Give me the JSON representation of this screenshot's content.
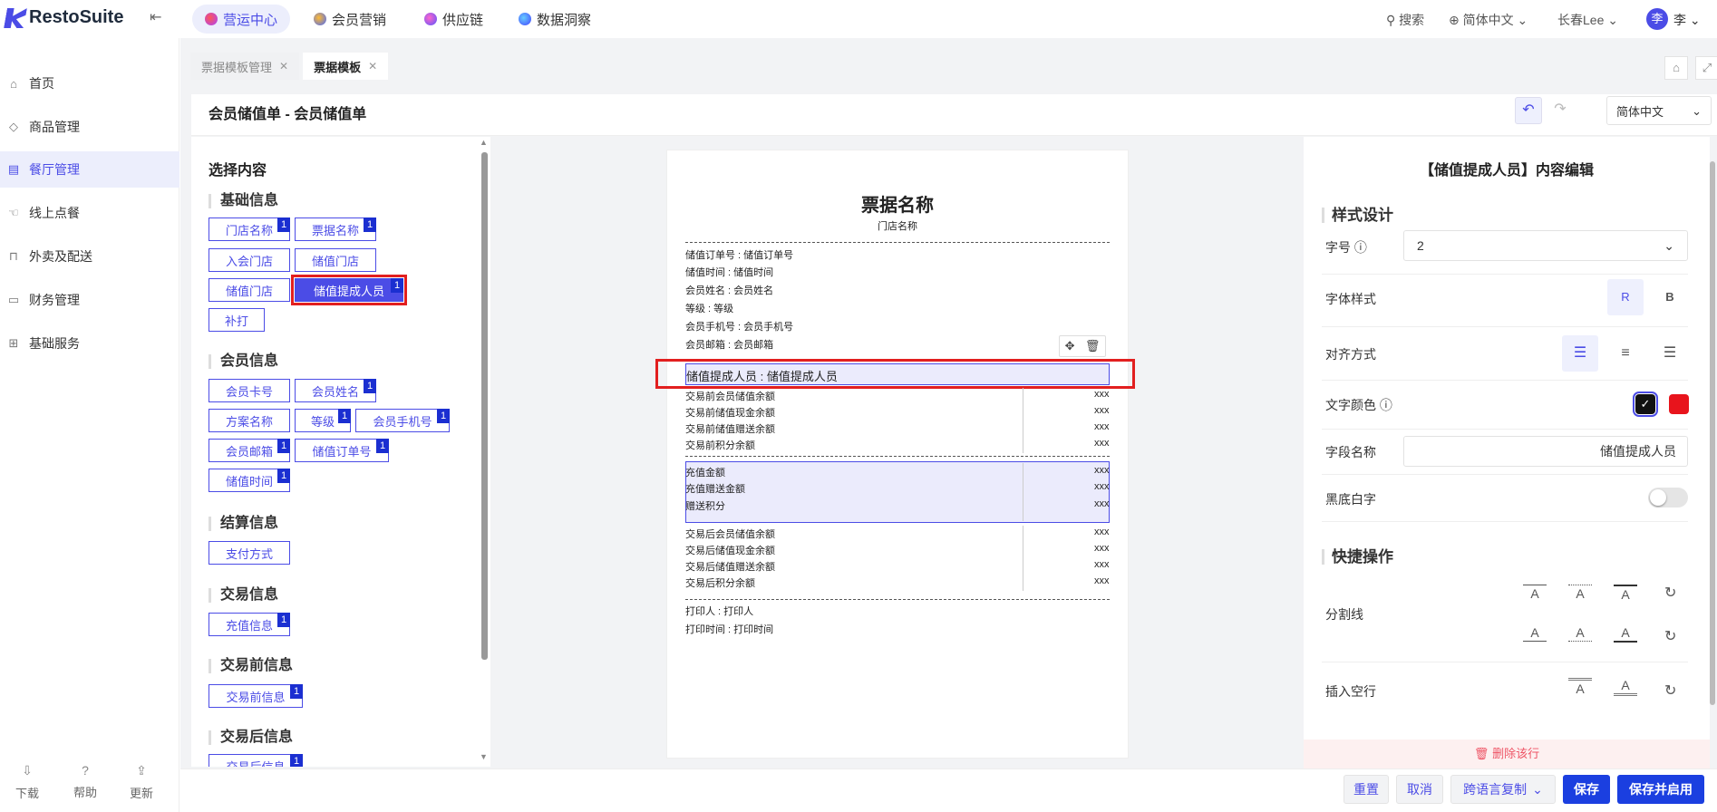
{
  "app": {
    "name": "RestoSuite"
  },
  "topnav": {
    "tabs": [
      {
        "label": "营运中心"
      },
      {
        "label": "会员营销"
      },
      {
        "label": "供应链"
      },
      {
        "label": "数据洞察"
      }
    ],
    "search": "搜索",
    "language": "简体中文",
    "store": "长春Lee",
    "avatar": "李",
    "user": "李"
  },
  "sidebar": {
    "items": [
      {
        "label": "首页"
      },
      {
        "label": "商品管理"
      },
      {
        "label": "餐厅管理"
      },
      {
        "label": "线上点餐"
      },
      {
        "label": "外卖及配送"
      },
      {
        "label": "财务管理"
      },
      {
        "label": "基础服务"
      }
    ],
    "footer": [
      {
        "label": "下载"
      },
      {
        "label": "帮助"
      },
      {
        "label": "更新"
      }
    ]
  },
  "pagetabs": [
    {
      "label": "票据模板管理"
    },
    {
      "label": "票据模板"
    }
  ],
  "header": {
    "title": "会员储值单 - 会员储值单",
    "language": "简体中文"
  },
  "left": {
    "title": "选择内容",
    "sections": [
      {
        "title": "基础信息",
        "chips": [
          {
            "label": "门店名称",
            "badge": "1"
          },
          {
            "label": "票据名称",
            "badge": "1"
          },
          {
            "label": "入会门店",
            "badge": ""
          },
          {
            "label": "储值门店",
            "badge": ""
          },
          {
            "label": "储值门店",
            "badge": ""
          },
          {
            "label": "储值提成人员",
            "badge": "1"
          },
          {
            "label": "补打",
            "badge": ""
          }
        ]
      },
      {
        "title": "会员信息",
        "chips": [
          {
            "label": "会员卡号",
            "badge": ""
          },
          {
            "label": "会员姓名",
            "badge": "1"
          },
          {
            "label": "方案名称",
            "badge": ""
          },
          {
            "label": "等级",
            "badge": "1"
          },
          {
            "label": "会员手机号",
            "badge": "1"
          },
          {
            "label": "会员邮箱",
            "badge": "1"
          },
          {
            "label": "储值订单号",
            "badge": "1"
          },
          {
            "label": "储值时间",
            "badge": "1"
          }
        ]
      },
      {
        "title": "结算信息",
        "chips": [
          {
            "label": "支付方式",
            "badge": ""
          }
        ]
      },
      {
        "title": "交易信息",
        "chips": [
          {
            "label": "充值信息",
            "badge": "1"
          }
        ]
      },
      {
        "title": "交易前信息",
        "chips": [
          {
            "label": "交易前信息",
            "badge": "1"
          }
        ]
      },
      {
        "title": "交易后信息",
        "chips": [
          {
            "label": "交易后信息",
            "badge": "1"
          }
        ]
      }
    ]
  },
  "receipt": {
    "title": "票据名称",
    "store": "门店名称",
    "info": [
      "储值订单号 : 储值订单号",
      "储值时间 : 储值时间",
      "会员姓名 : 会员姓名",
      "等级 : 等级",
      "会员手机号 : 会员手机号",
      "会员邮箱 : 会员邮箱"
    ],
    "selected": "储值提成人员 : 储值提成人员",
    "before": [
      {
        "k": "交易前会员储值余额",
        "v": "xxx"
      },
      {
        "k": "交易前储值现金余额",
        "v": "xxx"
      },
      {
        "k": "交易前储值赠送余额",
        "v": "xxx"
      },
      {
        "k": "交易前积分余额",
        "v": "xxx"
      }
    ],
    "recharge": [
      {
        "k": "充值金额",
        "v": "xxx"
      },
      {
        "k": "充值赠送金额",
        "v": "xxx"
      },
      {
        "k": "赠送积分",
        "v": "xxx"
      }
    ],
    "after": [
      {
        "k": "交易后会员储值余额",
        "v": "xxx"
      },
      {
        "k": "交易后储值现金余额",
        "v": "xxx"
      },
      {
        "k": "交易后储值赠送余额",
        "v": "xxx"
      },
      {
        "k": "交易后积分余额",
        "v": "xxx"
      }
    ],
    "footer": [
      "打印人 : 打印人",
      "打印时间 : 打印时间"
    ]
  },
  "right": {
    "title": "【储值提成人员】内容编辑",
    "style_section": "样式设计",
    "font_size_label": "字号",
    "font_size_value": "2",
    "font_style_label": "字体样式",
    "font_style_regular": "R",
    "font_style_bold": "B",
    "align_label": "对齐方式",
    "color_label": "文字颜色",
    "colors": {
      "black": "#111111",
      "red": "#e8141c"
    },
    "field_name_label": "字段名称",
    "field_name_value": "储值提成人员",
    "invert_label": "黑底白字",
    "quick_section": "快捷操作",
    "divider_label": "分割线",
    "blank_label": "插入空行",
    "divider_glyph": "A",
    "delete_label": "删除该行"
  },
  "bottom": {
    "reset": "重置",
    "cancel": "取消",
    "copy": "跨语言复制",
    "save": "保存",
    "save_enable": "保存并启用"
  },
  "theme": {
    "accent": "#4b4ce6",
    "primary": "#1b3fe0",
    "highlight": "#e21f1f"
  }
}
